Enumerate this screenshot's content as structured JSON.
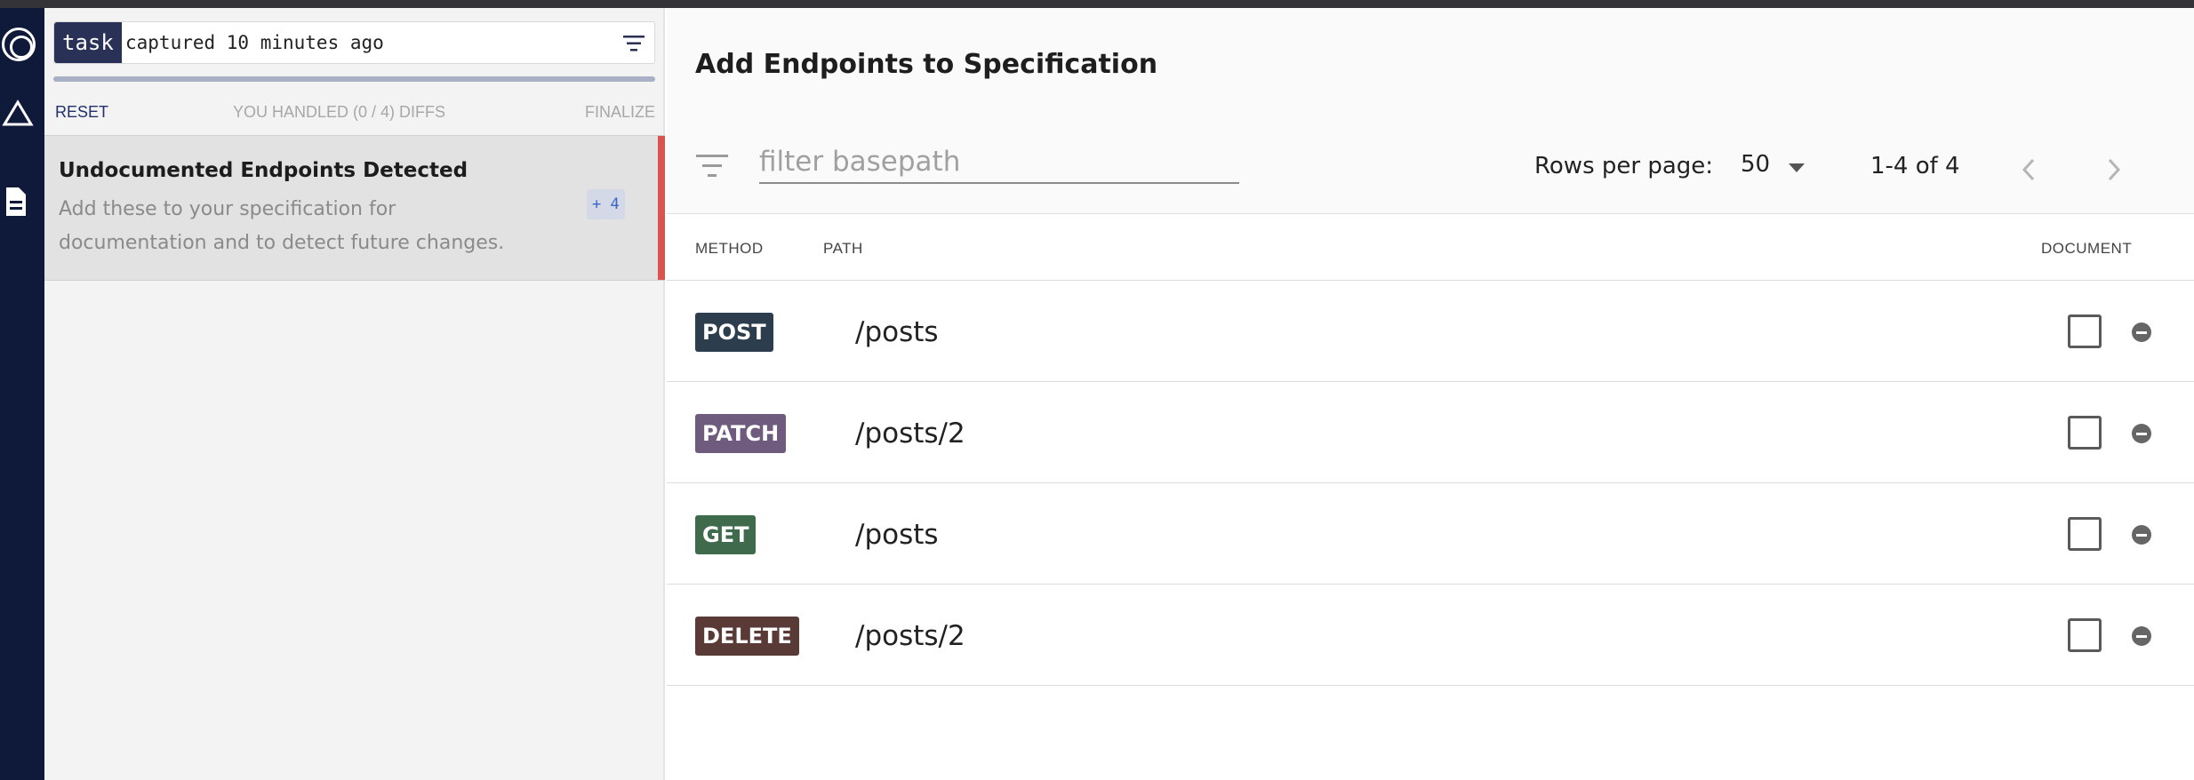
{
  "left_panel": {
    "search": {
      "chip": "task",
      "query": "captured 10 minutes ago",
      "progress_fraction": 0
    },
    "actions": {
      "reset": "RESET",
      "handled": "YOU HANDLED (0 / 4) DIFFS",
      "finalize": "FINALIZE"
    },
    "card": {
      "title": "Undocumented Endpoints Detected",
      "description": "Add these to your specification for documentation and to detect future changes.",
      "count": "+ 4"
    }
  },
  "main": {
    "title": "Add Endpoints to Specification",
    "filter_placeholder": "filter basepath",
    "rows_per_page_label": "Rows per page:",
    "rows_per_page_value": "50",
    "range": "1-4 of 4",
    "columns": {
      "method": "METHOD",
      "path": "PATH",
      "document": "DOCUMENT"
    },
    "endpoints": [
      {
        "method": "POST",
        "path": "/posts",
        "color": "#2c3e4d"
      },
      {
        "method": "PATCH",
        "path": "/posts/2",
        "color": "#6f5b7d"
      },
      {
        "method": "GET",
        "path": "/posts",
        "color": "#3f6b4c"
      },
      {
        "method": "DELETE",
        "path": "/posts/2",
        "color": "#5a3a36"
      }
    ]
  },
  "icons": {
    "rail": [
      "logo-icon",
      "triangle-icon",
      "document-icon"
    ],
    "filter": "filter-icon",
    "pager": [
      "chevron-left-icon",
      "chevron-right-icon"
    ],
    "row_action": "remove-circle-icon"
  },
  "colors": {
    "rail": "#0f1a3a",
    "accent": "#2a3156",
    "alert": "#d9534f"
  }
}
